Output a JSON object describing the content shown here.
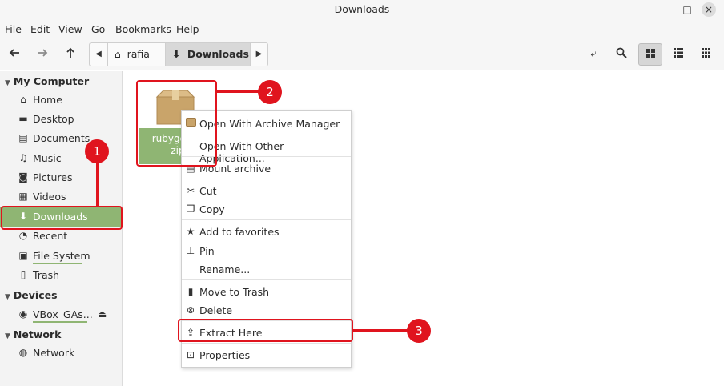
{
  "window": {
    "title": "Downloads",
    "controls": [
      "–",
      "□",
      "×"
    ]
  },
  "menubar": [
    "File",
    "Edit",
    "View",
    "Go",
    "Bookmarks",
    "Help"
  ],
  "toolbar": {
    "back_icon": "arrow-left-icon",
    "forward_icon": "arrow-right-icon",
    "up_icon": "arrow-up-icon",
    "path": [
      "rafia",
      "Downloads"
    ]
  },
  "sidebar": {
    "sections": [
      {
        "label": "My Computer",
        "items": [
          "Home",
          "Desktop",
          "Documents",
          "Music",
          "Pictures",
          "Videos",
          "Downloads",
          "Recent",
          "File System",
          "Trash"
        ]
      },
      {
        "label": "Devices",
        "items": [
          "VBox_GAs..."
        ]
      },
      {
        "label": "Network",
        "items": [
          "Network"
        ]
      }
    ],
    "active_item": "Downloads"
  },
  "file": {
    "name_line1": "rubygems-",
    "name_line2": "zip"
  },
  "context_menu": [
    "Open With Archive Manager",
    "Open With Other Application...",
    "Mount archive",
    "Cut",
    "Copy",
    "Add to favorites",
    "Pin",
    "Rename...",
    "Move to Trash",
    "Delete",
    "Extract Here",
    "Properties"
  ],
  "callouts": [
    "1",
    "2",
    "3"
  ],
  "colors": {
    "accent": "#8fb573",
    "callout": "#e0141e"
  }
}
